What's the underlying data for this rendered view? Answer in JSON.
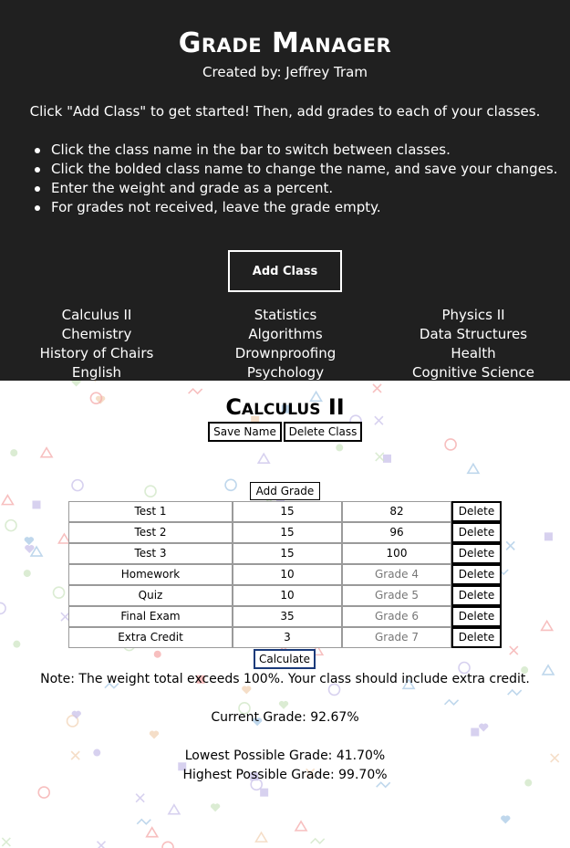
{
  "header": {
    "title": "Grade Manager",
    "author": "Created by: Jeffrey Tram",
    "intro": "Click \"Add Class\" to get started! Then, add grades to each of your classes.",
    "tips": [
      "Click the class name in the bar to switch between classes.",
      "Click the bolded class name to change the name, and save your changes.",
      "Enter the weight and grade as a percent.",
      "For grades not received, leave the grade empty."
    ],
    "add_class_label": "Add Class"
  },
  "classes": {
    "col1": [
      "Calculus II",
      "Chemistry",
      "History of Chairs",
      "English"
    ],
    "col2": [
      "Statistics",
      "Algorithms",
      "Drownproofing",
      "Psychology"
    ],
    "col3": [
      "Physics II",
      "Data Structures",
      "Health",
      "Cognitive Science"
    ]
  },
  "active_class": {
    "name": "Calculus II",
    "save_label": "Save Name",
    "delete_label": "Delete Class",
    "add_grade_label": "Add Grade",
    "grades": [
      {
        "name": "Test 1",
        "weight": "15",
        "grade": "82",
        "grade_placeholder": "",
        "delete_label": "Delete"
      },
      {
        "name": "Test 2",
        "weight": "15",
        "grade": "96",
        "grade_placeholder": "",
        "delete_label": "Delete"
      },
      {
        "name": "Test 3",
        "weight": "15",
        "grade": "100",
        "grade_placeholder": "",
        "delete_label": "Delete"
      },
      {
        "name": "Homework",
        "weight": "10",
        "grade": "",
        "grade_placeholder": "Grade 4",
        "delete_label": "Delete"
      },
      {
        "name": "Quiz",
        "weight": "10",
        "grade": "",
        "grade_placeholder": "Grade 5",
        "delete_label": "Delete"
      },
      {
        "name": "Final Exam",
        "weight": "35",
        "grade": "",
        "grade_placeholder": "Grade 6",
        "delete_label": "Delete"
      },
      {
        "name": "Extra Credit",
        "weight": "3",
        "grade": "",
        "grade_placeholder": "Grade 7",
        "delete_label": "Delete"
      }
    ],
    "calculate_label": "Calculate",
    "note": "Note: The weight total exceeds 100%. Your class should include extra credit.",
    "current_grade": "Current Grade: 92.67%",
    "lowest_grade": "Lowest Possible Grade: 41.70%",
    "highest_grade": "Highest Possible Grade: 99.70%"
  },
  "colors": {
    "header_bg": "#202020",
    "pattern_shapes": [
      "#f4a9a9",
      "#a9c9e6",
      "#c9c2ea",
      "#cfe6c4",
      "#f2d3b6"
    ]
  }
}
